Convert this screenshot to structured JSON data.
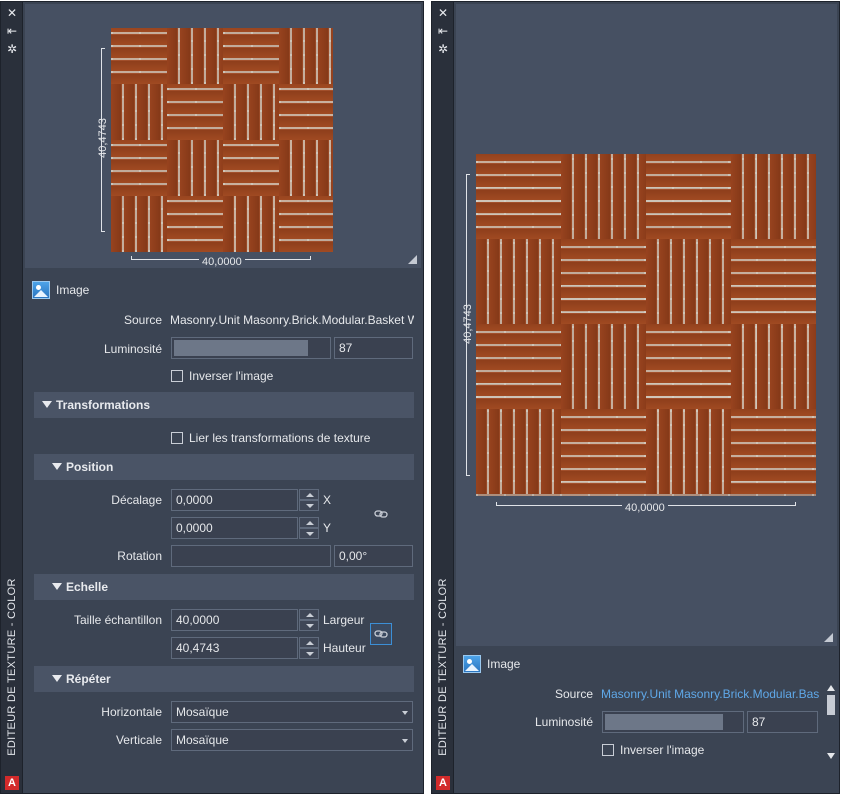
{
  "palette_left": {
    "titlebar": {
      "vertical_title": "EDITEUR DE TEXTURE - COLOR",
      "icons": [
        "close-icon",
        "auto-hide-icon",
        "properties-icon"
      ],
      "logo": "A"
    },
    "preview": {
      "height_label": "40,4743",
      "width_label": "40,0000"
    },
    "image_header": "Image",
    "source": {
      "label": "Source",
      "value": "Masonry.Unit Masonry.Brick.Modular.Basket W"
    },
    "brightness": {
      "label": "Luminosité",
      "value": "87",
      "level": 0.87
    },
    "invert": {
      "label": "Inverser l'image",
      "checked": false
    },
    "transforms": {
      "header": "Transformations",
      "link": {
        "label": "Lier les transformations de texture",
        "checked": false
      }
    },
    "position": {
      "header": "Position",
      "offset_label": "Décalage",
      "x_value": "0,0000",
      "x_axis": "X",
      "y_value": "0,0000",
      "y_axis": "Y",
      "rotation_label": "Rotation",
      "rotation_value": "0,00°"
    },
    "scale": {
      "header": "Echelle",
      "sample_label": "Taille échantillon",
      "width_value": "40,0000",
      "width_label": "Largeur",
      "height_value": "40,4743",
      "height_label": "Hauteur"
    },
    "repeat": {
      "header": "Répéter",
      "horizontal_label": "Horizontale",
      "horizontal_value": "Mosaïque",
      "vertical_label": "Verticale",
      "vertical_value": "Mosaïque"
    }
  },
  "palette_right": {
    "titlebar": {
      "vertical_title": "EDITEUR DE TEXTURE - COLOR",
      "logo": "A"
    },
    "preview": {
      "height_label": "40,4743",
      "width_label": "40,0000"
    },
    "image_header": "Image",
    "source": {
      "label": "Source",
      "value": "Masonry.Unit Masonry.Brick.Modular.Bas"
    },
    "brightness": {
      "label": "Luminosité",
      "value": "87",
      "level": 0.87
    },
    "invert": {
      "label": "Inverser l'image",
      "checked": false
    }
  },
  "colors": {
    "panel": "#3b4453",
    "header": "#4a5466",
    "titlebar": "#2a303b",
    "accent": "#3c8fd6",
    "link": "#5fa8e8",
    "logo": "#d32b2b"
  }
}
